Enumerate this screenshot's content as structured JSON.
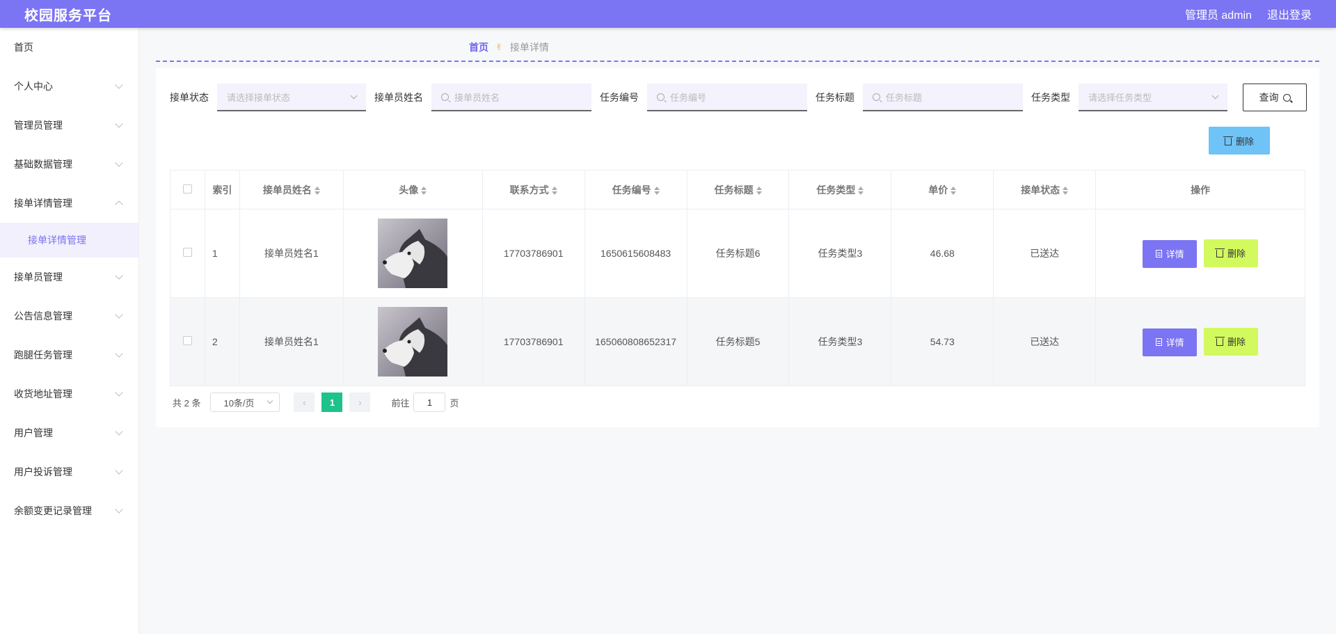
{
  "header": {
    "brand": "校园服务平台",
    "user": "管理员 admin",
    "logout": "退出登录"
  },
  "sidebar": {
    "items": [
      {
        "label": "首页"
      },
      {
        "label": "个人中心"
      },
      {
        "label": "管理员管理"
      },
      {
        "label": "基础数据管理"
      },
      {
        "label": "接单详情管理",
        "expanded": true,
        "children": [
          {
            "label": "接单详情管理"
          }
        ]
      },
      {
        "label": "接单员管理"
      },
      {
        "label": "公告信息管理"
      },
      {
        "label": "跑腿任务管理"
      },
      {
        "label": "收货地址管理"
      },
      {
        "label": "用户管理"
      },
      {
        "label": "用户投诉管理"
      },
      {
        "label": "余额变更记录管理"
      }
    ]
  },
  "breadcrumb": {
    "home": "首页",
    "separator": "✌",
    "current": "接单详情"
  },
  "filters": {
    "status": {
      "label": "接单状态",
      "placeholder": "请选择接单状态"
    },
    "name": {
      "label": "接单员姓名",
      "placeholder": "接单员姓名"
    },
    "task_no": {
      "label": "任务编号",
      "placeholder": "任务编号"
    },
    "task_title": {
      "label": "任务标题",
      "placeholder": "任务标题"
    },
    "task_type": {
      "label": "任务类型",
      "placeholder": "请选择任务类型"
    },
    "query_label": "查询"
  },
  "actions": {
    "delete_label": "删除"
  },
  "table": {
    "columns": [
      "索引",
      "接单员姓名",
      "头像",
      "联系方式",
      "任务编号",
      "任务标题",
      "任务类型",
      "单价",
      "接单状态",
      "操作"
    ],
    "rows": [
      {
        "index": "1",
        "name": "接单员姓名1",
        "phone": "17703786901",
        "task_no": "1650615608483",
        "title": "任务标题6",
        "type": "任务类型3",
        "price": "46.68",
        "status": "已送达"
      },
      {
        "index": "2",
        "name": "接单员姓名1",
        "phone": "17703786901",
        "task_no": "165060808652317",
        "title": "任务标题5",
        "type": "任务类型3",
        "price": "54.73",
        "status": "已送达"
      }
    ],
    "detail_label": "详情",
    "delete_label": "删除"
  },
  "pagination": {
    "total": "共 2 条",
    "page_size": "10条/页",
    "current_page": "1",
    "goto_label": "前往",
    "goto_value": "1",
    "page_suffix": "页"
  },
  "colors": {
    "accent": "#7b74f3",
    "delete_top": "#6fc3f7",
    "delete_row": "#d2fa5e",
    "page_active": "#1ec28b"
  }
}
